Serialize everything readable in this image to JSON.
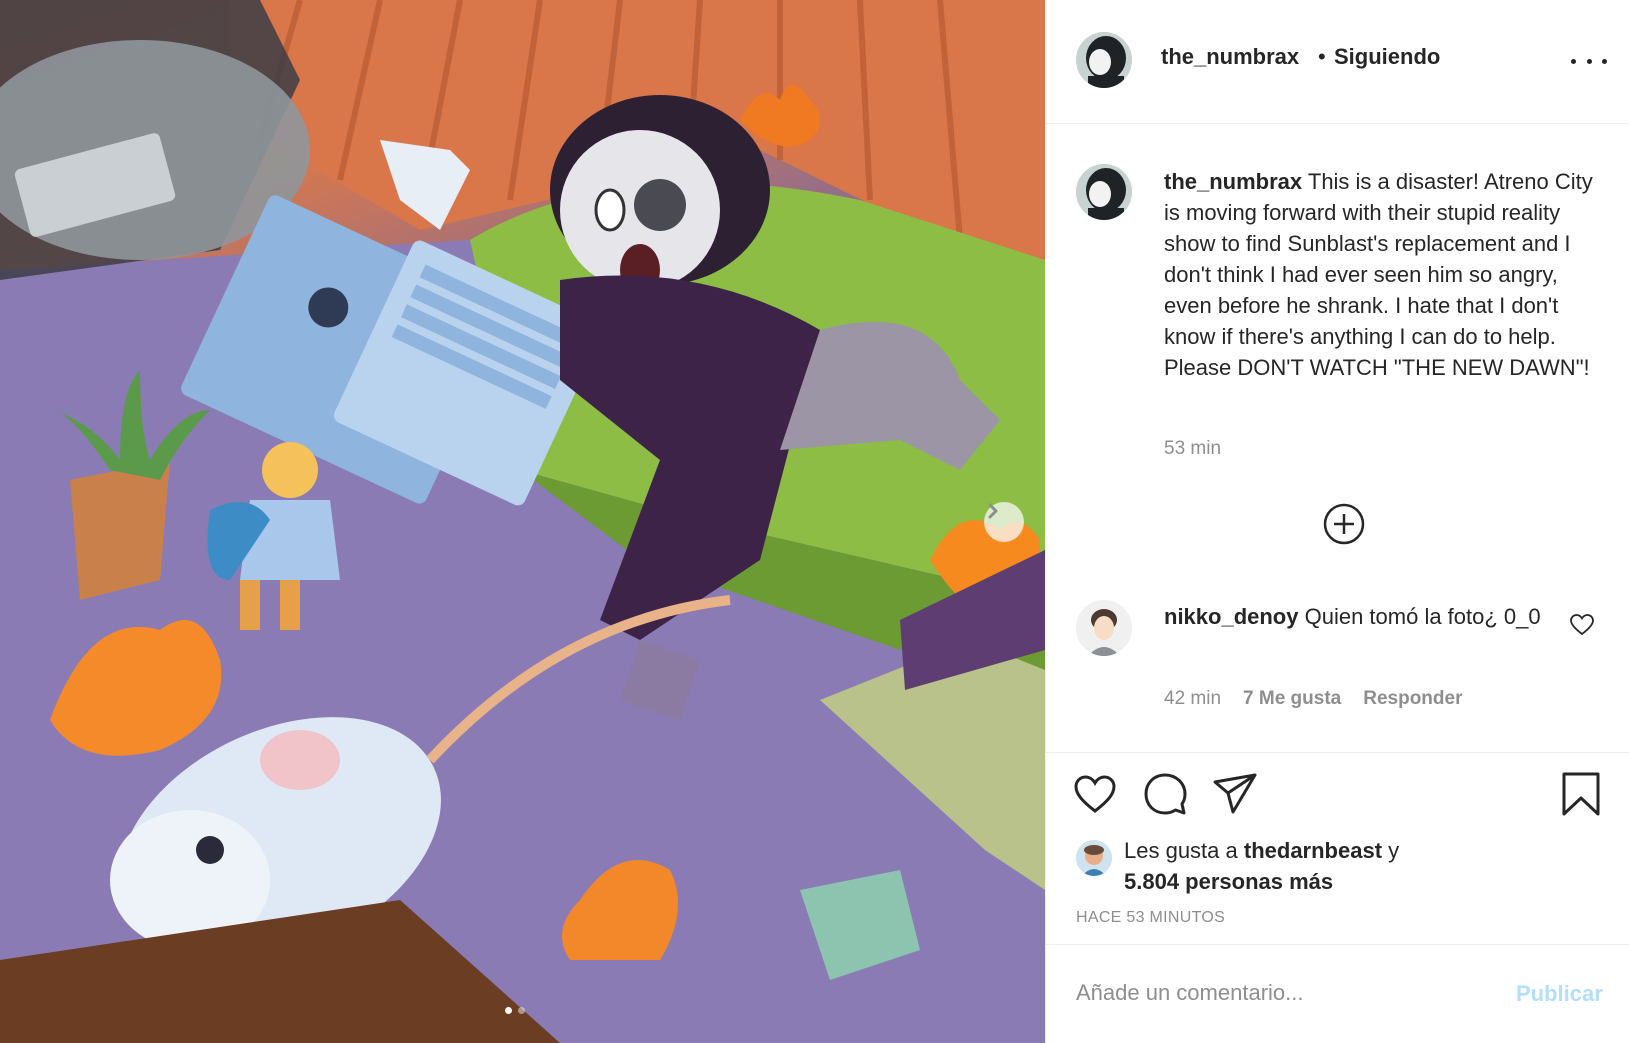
{
  "post": {
    "image_alt": "Ilustración: personaje cayendo con una laptop, un ratón blanco y un pequeño héroe rubio en una habitación en llamas",
    "carousel": {
      "total": 2,
      "current": 1
    },
    "next_icon": "chevron-right-icon"
  },
  "header": {
    "username": "the_numbrax",
    "separator": "•",
    "follow_status": "Siguiendo",
    "more_icon": "more-horizontal-icon"
  },
  "caption": {
    "username": "the_numbrax",
    "text": "This is a disaster! Atreno City is moving forward with their stupid reality show to find Sunblast's replacement and I don't think I had ever seen him so angry, even before he shrank. I hate that I don't know if there's anything I can do to help. Please DON'T WATCH \"THE NEW DAWN\"!",
    "time": "53 min"
  },
  "load_more_icon": "plus-circle-icon",
  "comments": [
    {
      "username": "nikko_denoy",
      "text": "Quien tomó la foto¿ 0_0",
      "time": "42 min",
      "likes": "7 Me gusta",
      "reply_label": "Responder"
    }
  ],
  "actions": {
    "like_icon": "heart-icon",
    "comment_icon": "speech-bubble-icon",
    "share_icon": "paper-plane-icon",
    "save_icon": "bookmark-icon"
  },
  "likes": {
    "prefix": "Les gusta a",
    "user": "thedarnbeast",
    "joiner": "y",
    "others": "5.804 personas más"
  },
  "timestamp": "HACE 53 MINUTOS",
  "comment_box": {
    "placeholder": "Añade un comentario...",
    "publish_label": "Publicar"
  },
  "colors": {
    "text": "#262626",
    "muted": "#8e8e8e",
    "border": "#efefef",
    "publish_disabled": "#b2dffc"
  }
}
